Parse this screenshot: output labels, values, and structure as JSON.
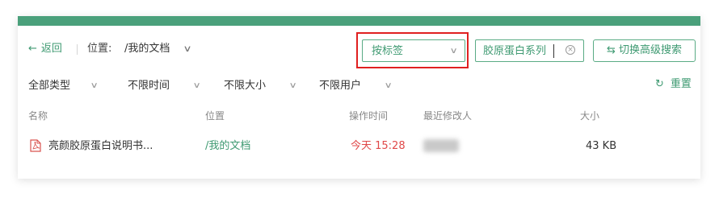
{
  "toolbar": {
    "back_label": "返回",
    "location_label": "位置:",
    "location_path": "/我的文档",
    "tag_select_value": "按标签",
    "search_value": "胶原蛋白系列",
    "advanced_search_label": "切换高级搜索"
  },
  "filters": [
    {
      "label": "全部类型"
    },
    {
      "label": "不限时间"
    },
    {
      "label": "不限大小"
    },
    {
      "label": "不限用户"
    }
  ],
  "reset_label": "重置",
  "table": {
    "headers": [
      "名称",
      "位置",
      "操作时间",
      "最近修改人",
      "大小"
    ],
    "rows": [
      {
        "name": "亮颜胶原蛋白说明书...",
        "path": "/我的文档",
        "time": "今天 15:28",
        "modifier": "",
        "size": "43 KB"
      }
    ]
  },
  "colors": {
    "accent": "#3f9a72",
    "header_bar": "#4aa07b",
    "highlight": "#e02020",
    "time_text": "#e04848",
    "pdf": "#d9534f"
  },
  "icons": {
    "back": "arrow-left-icon",
    "dropdown": "chevron-down-icon",
    "clear": "close-circle-icon",
    "advanced": "swap-icon",
    "reset": "refresh-icon",
    "file": "pdf-icon"
  }
}
